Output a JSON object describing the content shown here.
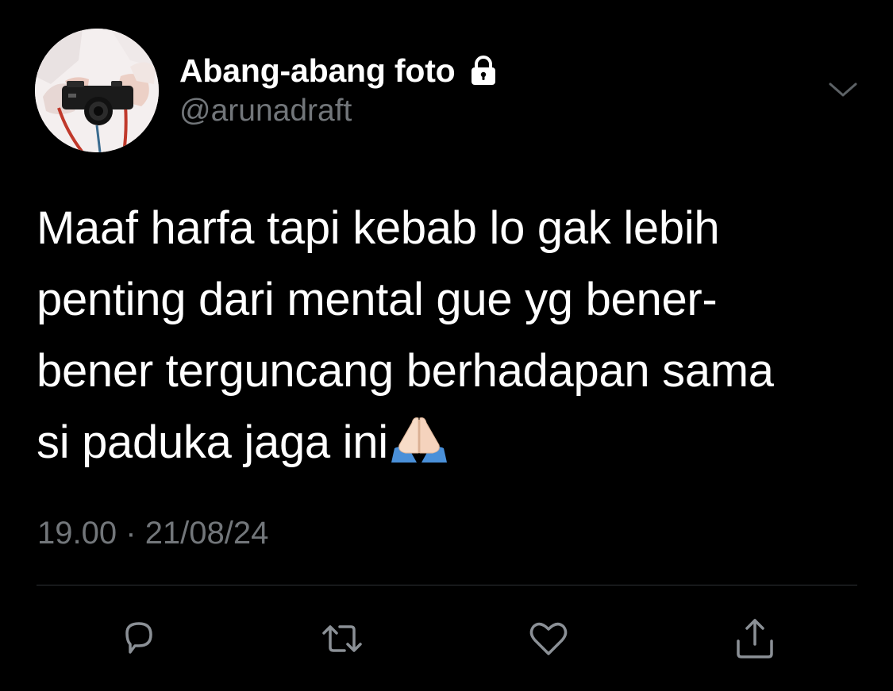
{
  "tweet": {
    "author": {
      "display_name": "Abang-abang foto",
      "handle": "@arunadraft",
      "protected_icon": "lock-icon",
      "avatar_icon": "camera-avatar"
    },
    "more_icon": "chevron-down-icon",
    "text_lines": [
      "Maaf harfa tapi kebab lo gak lebih",
      "penting dari mental gue yg bener-",
      "bener terguncang berhadapan sama",
      "si paduka jaga ini"
    ],
    "trailing_emoji": "folded-hands-emoji",
    "time": "19.00",
    "separator": "·",
    "date": "21/08/24",
    "actions": [
      {
        "name": "reply",
        "icon": "reply-icon"
      },
      {
        "name": "retweet",
        "icon": "retweet-icon"
      },
      {
        "name": "like",
        "icon": "heart-icon"
      },
      {
        "name": "share",
        "icon": "share-icon"
      }
    ]
  },
  "colors": {
    "background": "#000000",
    "primary_text": "#ffffff",
    "secondary_text": "#72767a",
    "divider": "#2f3336",
    "icon": "#8b9096"
  }
}
